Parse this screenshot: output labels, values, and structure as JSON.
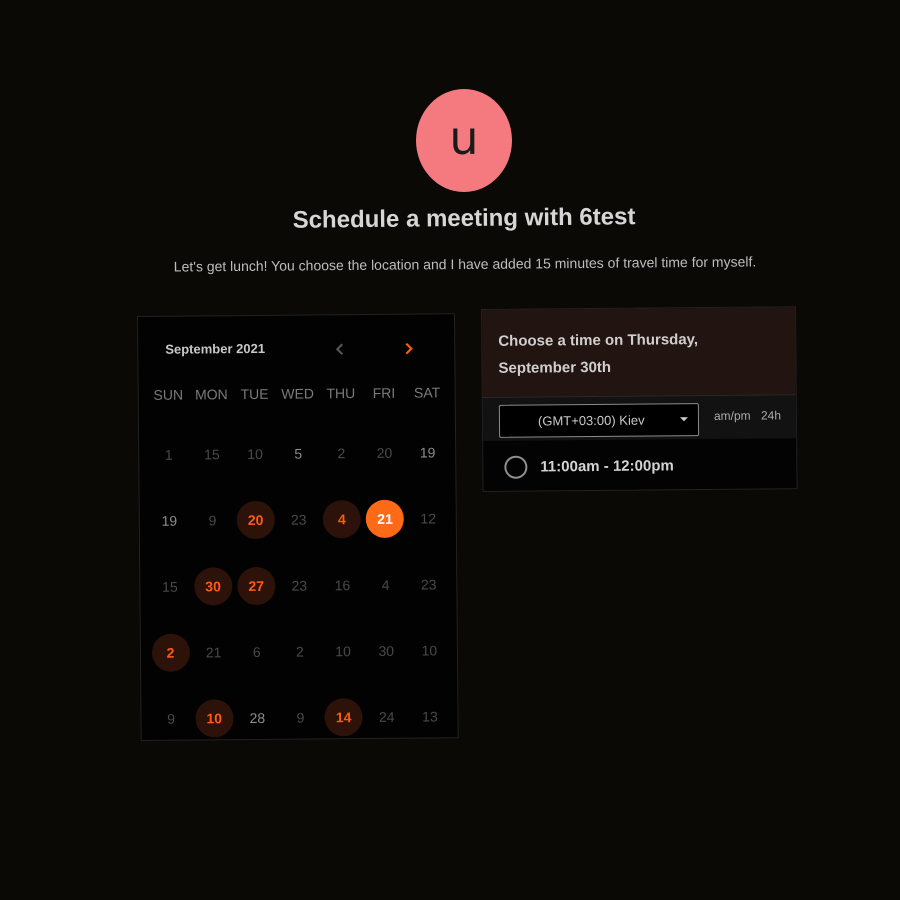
{
  "host": {
    "avatar_letter": "u",
    "avatar_color": "#f47a80",
    "title": "Schedule a meeting with 6test",
    "subtitle": "Let's get lunch! You choose the location and I have added 15 minutes of travel time for myself."
  },
  "calendar": {
    "month_label": "September 2021",
    "prev_icon": "chevron-left-icon",
    "next_icon": "chevron-right-icon",
    "weekdays": [
      "SUN",
      "MON",
      "TUE",
      "WED",
      "THU",
      "FRI",
      "SAT"
    ],
    "weeks": [
      [
        {
          "label": "1",
          "state": "dim"
        },
        {
          "label": "15",
          "state": "dim"
        },
        {
          "label": "10",
          "state": "dim"
        },
        {
          "label": "5",
          "state": "muted"
        },
        {
          "label": "2",
          "state": "dim"
        },
        {
          "label": "20",
          "state": "dim"
        },
        {
          "label": "19",
          "state": "muted"
        }
      ],
      [
        {
          "label": "19",
          "state": "muted"
        },
        {
          "label": "9",
          "state": "dim"
        },
        {
          "label": "20",
          "state": "available"
        },
        {
          "label": "23",
          "state": "dim"
        },
        {
          "label": "4",
          "state": "available"
        },
        {
          "label": "21",
          "state": "selected"
        },
        {
          "label": "12",
          "state": "dim"
        }
      ],
      [
        {
          "label": "15",
          "state": "dim"
        },
        {
          "label": "30",
          "state": "available"
        },
        {
          "label": "27",
          "state": "available"
        },
        {
          "label": "23",
          "state": "dim"
        },
        {
          "label": "16",
          "state": "dim"
        },
        {
          "label": "4",
          "state": "dim"
        },
        {
          "label": "23",
          "state": "dim"
        }
      ],
      [
        {
          "label": "2",
          "state": "available"
        },
        {
          "label": "21",
          "state": "dim"
        },
        {
          "label": "6",
          "state": "dim"
        },
        {
          "label": "2",
          "state": "dim"
        },
        {
          "label": "10",
          "state": "dim"
        },
        {
          "label": "30",
          "state": "dim"
        },
        {
          "label": "10",
          "state": "dim"
        }
      ],
      [
        {
          "label": "9",
          "state": "dim"
        },
        {
          "label": "10",
          "state": "available"
        },
        {
          "label": "28",
          "state": "muted"
        },
        {
          "label": "9",
          "state": "dim"
        },
        {
          "label": "14",
          "state": "available"
        },
        {
          "label": "24",
          "state": "dim"
        },
        {
          "label": "13",
          "state": "dim"
        }
      ]
    ],
    "colors": {
      "accent": "#ff6a16",
      "available_bg": "#2c1208",
      "available_text": "#ff5a14"
    }
  },
  "time_picker": {
    "heading": "Choose a time on Thursday, September 30th",
    "timezone": "(GMT+03:00) Kiev",
    "format_ampm": "am/pm",
    "format_24": "24h",
    "slots": [
      {
        "label": "11:00am - 12:00pm"
      }
    ]
  }
}
